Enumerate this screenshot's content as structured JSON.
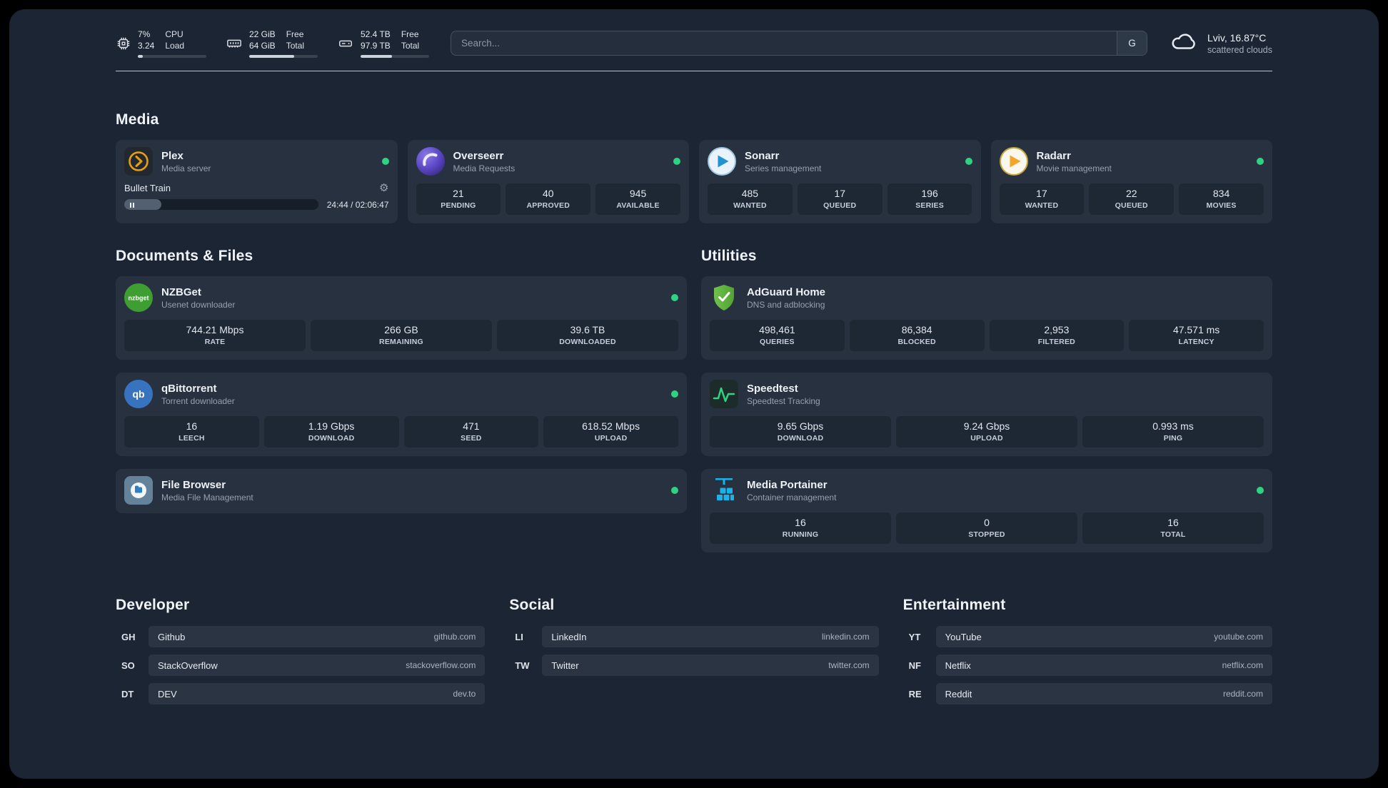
{
  "topbar": {
    "cpu": {
      "value1": "7%",
      "value2": "3.24",
      "label1": "CPU",
      "label2": "Load",
      "bar": 7
    },
    "memory": {
      "value1": "22 GiB",
      "value2": "64 GiB",
      "label1": "Free",
      "label2": "Total",
      "bar": 66
    },
    "disk": {
      "value1": "52.4 TB",
      "value2": "97.9 TB",
      "label1": "Free",
      "label2": "Total",
      "bar": 46
    },
    "search": {
      "placeholder": "Search...",
      "button_label": "G"
    },
    "weather": {
      "location": "Lviv, 16.87°C",
      "condition": "scattered clouds"
    }
  },
  "sections": {
    "media": {
      "title": "Media"
    },
    "documents": {
      "title": "Documents & Files"
    },
    "utilities": {
      "title": "Utilities"
    },
    "developer": {
      "title": "Developer"
    },
    "social": {
      "title": "Social"
    },
    "entertainment": {
      "title": "Entertainment"
    }
  },
  "status_color": "#2fd283",
  "services": {
    "plex": {
      "name": "Plex",
      "desc": "Media server",
      "now_playing": {
        "title": "Bullet Train",
        "time": "24:44 / 02:06:47",
        "progress_percent": 19
      }
    },
    "overseerr": {
      "name": "Overseerr",
      "desc": "Media Requests",
      "stats": [
        {
          "value": "21",
          "label": "PENDING"
        },
        {
          "value": "40",
          "label": "APPROVED"
        },
        {
          "value": "945",
          "label": "AVAILABLE"
        }
      ]
    },
    "sonarr": {
      "name": "Sonarr",
      "desc": "Series management",
      "stats": [
        {
          "value": "485",
          "label": "WANTED"
        },
        {
          "value": "17",
          "label": "QUEUED"
        },
        {
          "value": "196",
          "label": "SERIES"
        }
      ]
    },
    "radarr": {
      "name": "Radarr",
      "desc": "Movie management",
      "stats": [
        {
          "value": "17",
          "label": "WANTED"
        },
        {
          "value": "22",
          "label": "QUEUED"
        },
        {
          "value": "834",
          "label": "MOVIES"
        }
      ]
    },
    "nzbget": {
      "name": "NZBGet",
      "desc": "Usenet downloader",
      "stats": [
        {
          "value": "744.21 Mbps",
          "label": "RATE"
        },
        {
          "value": "266 GB",
          "label": "REMAINING"
        },
        {
          "value": "39.6 TB",
          "label": "DOWNLOADED"
        }
      ]
    },
    "qbittorrent": {
      "name": "qBittorrent",
      "desc": "Torrent downloader",
      "stats": [
        {
          "value": "16",
          "label": "LEECH"
        },
        {
          "value": "1.19 Gbps",
          "label": "DOWNLOAD"
        },
        {
          "value": "471",
          "label": "SEED"
        },
        {
          "value": "618.52 Mbps",
          "label": "UPLOAD"
        }
      ]
    },
    "filebrowser": {
      "name": "File Browser",
      "desc": "Media File Management"
    },
    "adguard": {
      "name": "AdGuard Home",
      "desc": "DNS and adblocking",
      "stats": [
        {
          "value": "498,461",
          "label": "QUERIES"
        },
        {
          "value": "86,384",
          "label": "BLOCKED"
        },
        {
          "value": "2,953",
          "label": "FILTERED"
        },
        {
          "value": "47.571 ms",
          "label": "LATENCY"
        }
      ]
    },
    "speedtest": {
      "name": "Speedtest",
      "desc": "Speedtest Tracking",
      "stats": [
        {
          "value": "9.65 Gbps",
          "label": "DOWNLOAD"
        },
        {
          "value": "9.24 Gbps",
          "label": "UPLOAD"
        },
        {
          "value": "0.993 ms",
          "label": "PING"
        }
      ]
    },
    "portainer": {
      "name": "Media Portainer",
      "desc": "Container management",
      "stats": [
        {
          "value": "16",
          "label": "RUNNING"
        },
        {
          "value": "0",
          "label": "STOPPED"
        },
        {
          "value": "16",
          "label": "TOTAL"
        }
      ]
    }
  },
  "bookmarks": {
    "developer": [
      {
        "abbr": "GH",
        "name": "Github",
        "url": "github.com"
      },
      {
        "abbr": "SO",
        "name": "StackOverflow",
        "url": "stackoverflow.com"
      },
      {
        "abbr": "DT",
        "name": "DEV",
        "url": "dev.to"
      }
    ],
    "social": [
      {
        "abbr": "LI",
        "name": "LinkedIn",
        "url": "linkedin.com"
      },
      {
        "abbr": "TW",
        "name": "Twitter",
        "url": "twitter.com"
      }
    ],
    "entertainment": [
      {
        "abbr": "YT",
        "name": "YouTube",
        "url": "youtube.com"
      },
      {
        "abbr": "NF",
        "name": "Netflix",
        "url": "netflix.com"
      },
      {
        "abbr": "RE",
        "name": "Reddit",
        "url": "reddit.com"
      }
    ]
  }
}
